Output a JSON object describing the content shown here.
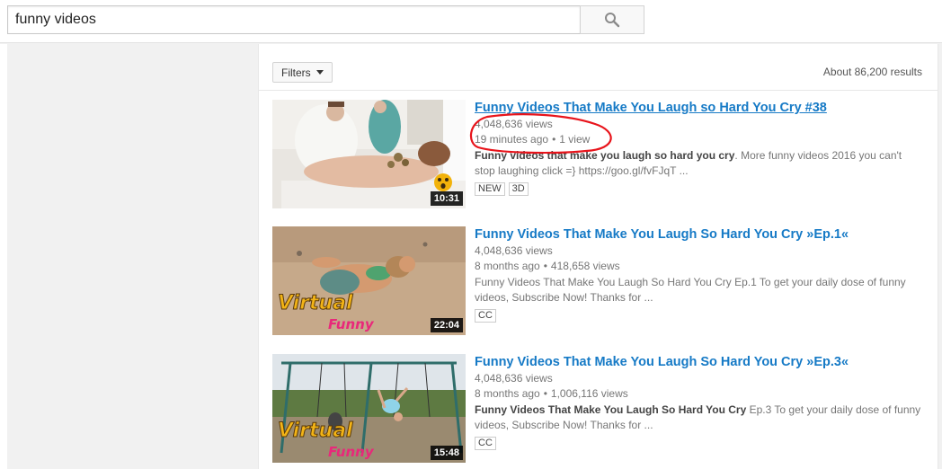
{
  "search": {
    "query": "funny videos",
    "button_icon": "search-icon"
  },
  "filters": {
    "label": "Filters",
    "result_count": "About 86,200 results"
  },
  "videos": [
    {
      "title": "Funny Videos That Make You Laugh so Hard You Cry #38",
      "line1": "4,048,636 views",
      "age": "19 minutes ago",
      "views": "1 view",
      "desc_bold": "Funny videos that make you laugh so hard you cry",
      "desc_rest": ". More funny videos 2016 you can't stop laughing click =} https://goo.gl/fvFJqT ...",
      "duration": "10:31",
      "badges": [
        "NEW",
        "3D"
      ]
    },
    {
      "title": "Funny Videos That Make You Laugh So Hard You Cry »Ep.1«",
      "line1": "4,048,636 views",
      "age": "8 months ago",
      "views": "418,658 views",
      "desc_bold": "",
      "desc_rest": "Funny Videos That Make You Laugh So Hard You Cry Ep.1 To get your daily dose of funny videos, Subscribe Now! Thanks for ...",
      "duration": "22:04",
      "thumb_text": [
        "Virtual",
        "Funny"
      ],
      "badges": [
        "CC"
      ]
    },
    {
      "title": "Funny Videos That Make You Laugh So Hard You Cry »Ep.3«",
      "line1": "4,048,636 views",
      "age": "8 months ago",
      "views": "1,006,116 views",
      "desc_bold": "Funny Videos That Make You Laugh So Hard You Cry",
      "desc_rest": " Ep.3 To get your daily dose of funny videos, Subscribe Now! Thanks for ...",
      "duration": "15:48",
      "thumb_text": [
        "Virtual",
        "Funny"
      ],
      "badges": [
        "CC"
      ]
    }
  ],
  "colors": {
    "link": "#167ac6",
    "annotation": "#e8141b"
  }
}
